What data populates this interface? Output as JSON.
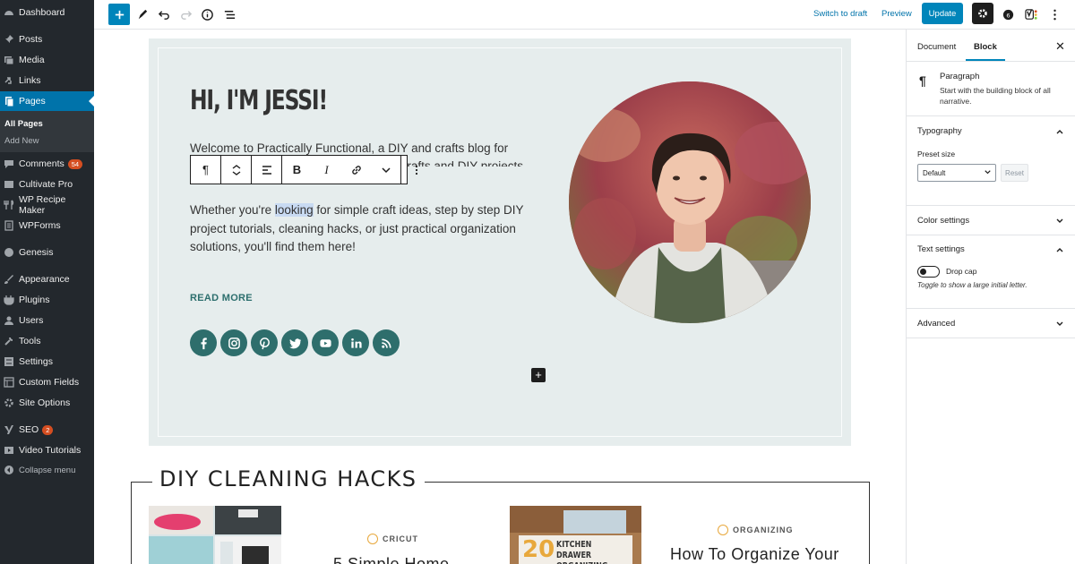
{
  "sidebar": {
    "items": [
      {
        "label": "Dashboard",
        "icon": "dashboard-icon"
      },
      {
        "label": "Posts",
        "icon": "pin-icon"
      },
      {
        "label": "Media",
        "icon": "media-icon"
      },
      {
        "label": "Links",
        "icon": "link-icon"
      },
      {
        "label": "Pages",
        "icon": "page-icon"
      },
      {
        "label": "Comments",
        "icon": "comment-icon",
        "badge": "54"
      },
      {
        "label": "Cultivate Pro",
        "icon": "admin-page-icon"
      },
      {
        "label": "WP Recipe Maker",
        "icon": "utensils-icon"
      },
      {
        "label": "WPForms",
        "icon": "form-icon"
      },
      {
        "label": "Genesis",
        "icon": "genesis-icon"
      },
      {
        "label": "Appearance",
        "icon": "brush-icon"
      },
      {
        "label": "Plugins",
        "icon": "plugin-icon"
      },
      {
        "label": "Users",
        "icon": "users-icon"
      },
      {
        "label": "Tools",
        "icon": "wrench-icon"
      },
      {
        "label": "Settings",
        "icon": "settings-icon"
      },
      {
        "label": "Custom Fields",
        "icon": "fields-icon"
      },
      {
        "label": "Site Options",
        "icon": "gear-icon"
      },
      {
        "label": "SEO",
        "icon": "yoast-icon",
        "badge": "2"
      },
      {
        "label": "Video Tutorials",
        "icon": "video-icon"
      }
    ],
    "submenu": {
      "all_pages": "All Pages",
      "add_new": "Add New"
    },
    "collapse": "Collapse menu"
  },
  "toolbar": {
    "switch_to_draft": "Switch to draft",
    "preview": "Preview",
    "update": "Update"
  },
  "hero": {
    "title": "HI, I'M JESSI!",
    "p1": "Welcome to Practically Functional, a DIY and crafts blog for everyone! I believe that anyone can do crafts and DIY projects,",
    "p2_before": "Whether you're ",
    "p2_highlight": "looking",
    "p2_after": " for simple craft ideas, step by step DIY project tutorials, cleaning hacks, or just practical organization solutions, you'll find them here!",
    "read_more": "READ MORE",
    "social": [
      "facebook-icon",
      "instagram-icon",
      "pinterest-icon",
      "twitter-icon",
      "youtube-icon",
      "linkedin-icon",
      "rss-icon"
    ]
  },
  "section": {
    "title": "DIY CLEANING HACKS",
    "posts": [
      {
        "category": "CRICUT",
        "title": "5 Simple Home"
      },
      {
        "category": "ORGANIZING",
        "title": "How To Organize Your",
        "thumb_text_big": "20",
        "thumb_text": "KITCHEN DRAWER ORGANIZING IDEAS"
      }
    ]
  },
  "inspector": {
    "tabs": [
      "Document",
      "Block"
    ],
    "block": {
      "name": "Paragraph",
      "description": "Start with the building block of all narrative."
    },
    "typography": {
      "title": "Typography",
      "preset_label": "Preset size",
      "preset_value": "Default",
      "reset": "Reset"
    },
    "color_settings": "Color settings",
    "text_settings": {
      "title": "Text settings",
      "drop_cap": "Drop cap",
      "help": "Toggle to show a large initial letter."
    },
    "advanced": "Advanced"
  },
  "colors": {
    "admin_bg": "#23282d",
    "accent": "#0085ba",
    "hero_bg": "#e6eded",
    "social": "#2e6e6c"
  }
}
